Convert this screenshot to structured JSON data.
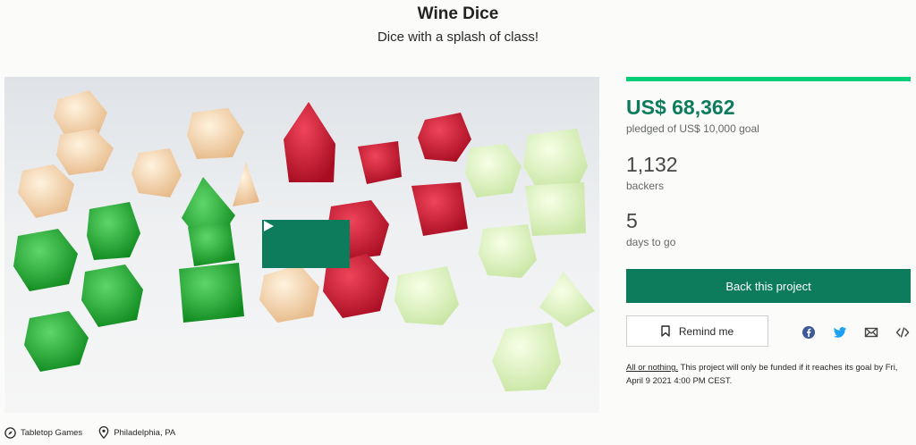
{
  "project": {
    "title": "Wine Dice",
    "subtitle": "Dice with a splash of class!"
  },
  "video": {
    "play_icon": "play-icon"
  },
  "funding": {
    "pledged": "US$ 68,362",
    "pledged_label": "pledged of US$ 10,000 goal",
    "progress_fraction": 1.0,
    "backers": "1,132",
    "backers_label": "backers",
    "days": "5",
    "days_label": "days to go"
  },
  "actions": {
    "back_label": "Back this project",
    "remind_label": "Remind me",
    "share_icons": [
      "facebook-icon",
      "twitter-icon",
      "email-icon",
      "embed-icon"
    ]
  },
  "fine_print": {
    "link": "All or nothing.",
    "text": " This project will only be funded if it reaches its goal by Fri, April 9 2021 4:00 PM CEST."
  },
  "tags": {
    "category": "Tabletop Games",
    "location": "Philadelphia, PA"
  },
  "colors": {
    "brand_green": "#0c7c5d",
    "progress_green": "#05ce78"
  }
}
